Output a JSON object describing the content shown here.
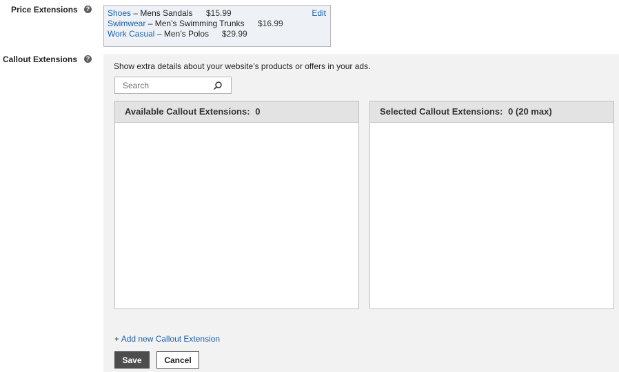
{
  "price_extensions": {
    "label": "Price Extensions",
    "help_icon": "question-circle-icon",
    "edit_label": "Edit",
    "items": [
      {
        "category": "Shoes",
        "separator": "–",
        "name": "Mens Sandals",
        "price": "$15.99"
      },
      {
        "category": "Swimwear",
        "separator": "–",
        "name": "Men’s Swimming Trunks",
        "price": "$16.99"
      },
      {
        "category": "Work Casual",
        "separator": "–",
        "name": "Men’s Polos",
        "price": "$29.99"
      }
    ]
  },
  "callout_extensions": {
    "label": "Callout Extensions",
    "help_icon": "question-circle-icon",
    "description": "Show extra details about your website’s products or offers in your ads.",
    "search": {
      "placeholder": "Search",
      "value": ""
    },
    "available": {
      "label": "Available Callout Extensions:",
      "count": "0"
    },
    "selected": {
      "label": "Selected Callout Extensions:",
      "count": "0 (20 max)"
    },
    "add_link": {
      "prefix": "+",
      "label": "Add new Callout Extension"
    },
    "save_label": "Save",
    "cancel_label": "Cancel"
  },
  "colors": {
    "link": "#1a5fa8",
    "panel_bg": "#f2f2f2",
    "price_box_bg": "#eef2f6",
    "save_button_bg": "#4d4d4d"
  }
}
